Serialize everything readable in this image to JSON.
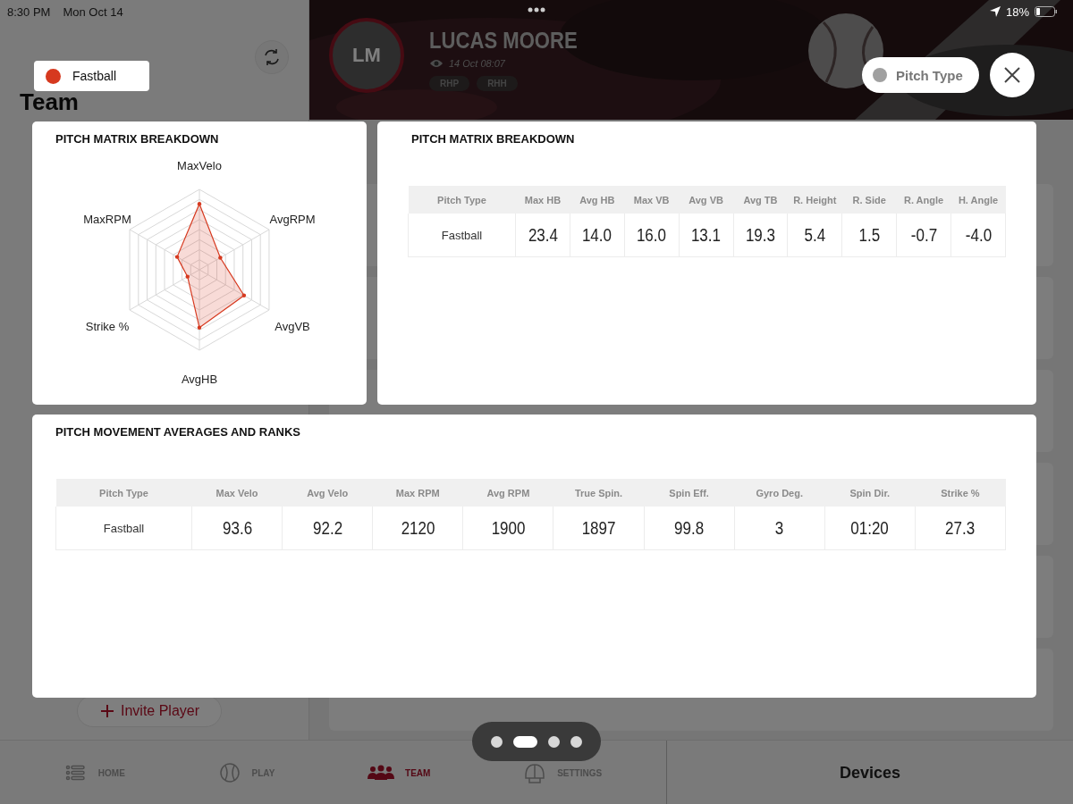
{
  "status_bar": {
    "time": "8:30 PM",
    "date": "Mon Oct 14",
    "battery": "18%"
  },
  "sidebar": {
    "title": "Team",
    "invite_button": "Invite Player"
  },
  "player": {
    "initials": "LM",
    "name": "LUCAS MOORE",
    "updated": "14 Oct 08:07",
    "tags": [
      "RHP",
      "RHH"
    ]
  },
  "pitch_type_button": {
    "label": "Pitch Type"
  },
  "pitch_filter": {
    "label": "Fastball",
    "color": "#d6391f"
  },
  "radar_card": {
    "title": "PITCH MATRIX BREAKDOWN",
    "axes": [
      "MaxVelo",
      "AvgRPM",
      "AvgVB",
      "AvgHB",
      "Strike %",
      "MaxRPM"
    ]
  },
  "matrix_card": {
    "title": "PITCH MATRIX BREAKDOWN",
    "columns": [
      "Pitch Type",
      "Max HB",
      "Avg HB",
      "Max VB",
      "Avg VB",
      "Avg TB",
      "R. Height",
      "R. Side",
      "R. Angle",
      "H. Angle"
    ],
    "rows": [
      [
        "Fastball",
        "23.4",
        "14.0",
        "16.0",
        "13.1",
        "19.3",
        "5.4",
        "1.5",
        "-0.7",
        "-4.0"
      ]
    ]
  },
  "movement_card": {
    "title": "PITCH MOVEMENT AVERAGES AND RANKS",
    "columns": [
      "Pitch Type",
      "Max Velo",
      "Avg Velo",
      "Max RPM",
      "Avg RPM",
      "True Spin.",
      "Spin Eff.",
      "Gyro Deg.",
      "Spin Dir.",
      "Strike %"
    ],
    "rows": [
      [
        "Fastball",
        "93.6",
        "92.2",
        "2120",
        "1900",
        "1897",
        "99.8",
        "3",
        "01:20",
        "27.3"
      ]
    ]
  },
  "page_dots": [
    {
      "selected": false
    },
    {
      "selected": true
    },
    {
      "selected": false
    },
    {
      "selected": false
    }
  ],
  "nav": {
    "items": [
      {
        "label": "HOME",
        "kind": "list",
        "selected": false
      },
      {
        "label": "PLAY",
        "kind": "ball",
        "selected": false
      },
      {
        "label": "TEAM",
        "kind": "team",
        "selected": true
      },
      {
        "label": "SETTINGS",
        "kind": "helmet",
        "selected": false
      }
    ],
    "devices": "Devices"
  }
}
